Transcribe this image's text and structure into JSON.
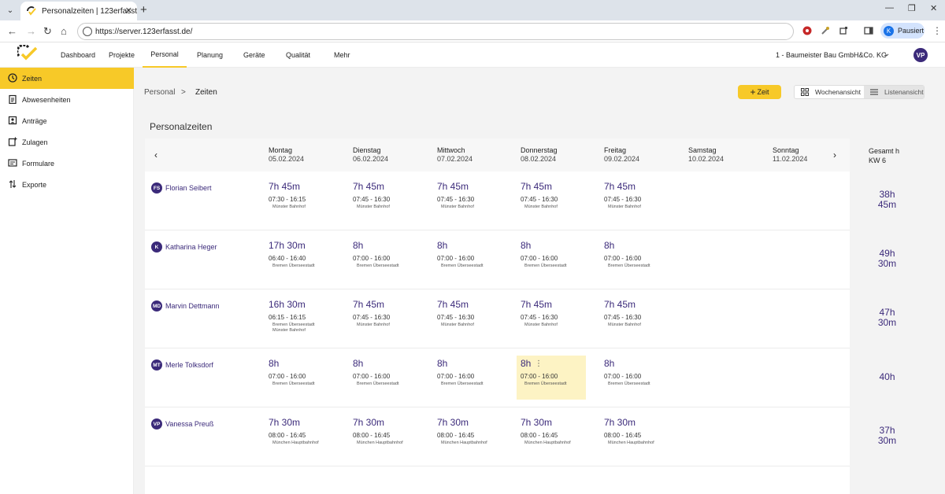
{
  "browser": {
    "tab_title": "Personalzeiten | 123erfasst",
    "url": "https://server.123erfasst.de/",
    "profile_label": "Pausiert",
    "profile_initial": "K"
  },
  "header": {
    "nav": [
      "Dashboard",
      "Projekte",
      "Personal",
      "Planung",
      "Geräte",
      "Qualität",
      "Mehr"
    ],
    "active_nav": "Personal",
    "company": "1 - Baumeister Bau GmbH&Co. KG",
    "user_initials": "VP"
  },
  "sidebar": {
    "items": [
      {
        "label": "Zeiten",
        "icon": "clock-icon",
        "active": true
      },
      {
        "label": "Abwesenheiten",
        "icon": "clipboard-icon",
        "active": false
      },
      {
        "label": "Anträge",
        "icon": "id-card-icon",
        "active": false
      },
      {
        "label": "Zulagen",
        "icon": "add-document-icon",
        "active": false
      },
      {
        "label": "Formulare",
        "icon": "form-icon",
        "active": false
      },
      {
        "label": "Exporte",
        "icon": "export-arrows-icon",
        "active": false
      }
    ]
  },
  "breadcrumb": {
    "parent": "Personal",
    "separator": ">",
    "current": "Zeiten"
  },
  "toolbar": {
    "add_label": "Zeit",
    "week_view_label": "Wochenansicht",
    "list_view_label": "Listenansicht"
  },
  "page_title": "Personalzeiten",
  "week": {
    "days": [
      {
        "name": "Montag",
        "date": "05.02.2024"
      },
      {
        "name": "Dienstag",
        "date": "06.02.2024"
      },
      {
        "name": "Mittwoch",
        "date": "07.02.2024"
      },
      {
        "name": "Donnerstag",
        "date": "08.02.2024"
      },
      {
        "name": "Freitag",
        "date": "09.02.2024"
      },
      {
        "name": "Samstag",
        "date": "10.02.2024"
      },
      {
        "name": "Sonntag",
        "date": "11.02.2024"
      }
    ],
    "total_label": "Gesamt h",
    "week_label": "KW 6"
  },
  "employees": [
    {
      "initials": "FS",
      "name": "Florian Seibert",
      "total_h": "38h",
      "total_m": "45m",
      "entries": [
        {
          "hours": "7h 45m",
          "range": "07:30 - 16:15",
          "locations": [
            "Münster Bahnhof"
          ]
        },
        {
          "hours": "7h 45m",
          "range": "07:45 - 16:30",
          "locations": [
            "Münster Bahnhof"
          ]
        },
        {
          "hours": "7h 45m",
          "range": "07:45 - 16:30",
          "locations": [
            "Münster Bahnhof"
          ]
        },
        {
          "hours": "7h 45m",
          "range": "07:45 - 16:30",
          "locations": [
            "Münster Bahnhof"
          ]
        },
        {
          "hours": "7h 45m",
          "range": "07:45 - 16:30",
          "locations": [
            "Münster Bahnhof"
          ]
        }
      ]
    },
    {
      "initials": "K",
      "name": "Katharina Heger",
      "total_h": "49h",
      "total_m": "30m",
      "entries": [
        {
          "hours": "17h 30m",
          "range": "06:40 - 16:40",
          "locations": [
            "Bremen Überseestadt"
          ]
        },
        {
          "hours": "8h",
          "range": "07:00 - 16:00",
          "locations": [
            "Bremen Überseestadt"
          ]
        },
        {
          "hours": "8h",
          "range": "07:00 - 16:00",
          "locations": [
            "Bremen Überseestadt"
          ]
        },
        {
          "hours": "8h",
          "range": "07:00 - 16:00",
          "locations": [
            "Bremen Überseestadt"
          ]
        },
        {
          "hours": "8h",
          "range": "07:00 - 16:00",
          "locations": [
            "Bremen Überseestadt"
          ]
        }
      ]
    },
    {
      "initials": "MD",
      "name": "Marvin Dettmann",
      "total_h": "47h",
      "total_m": "30m",
      "entries": [
        {
          "hours": "16h 30m",
          "range": "06:15 - 16:15",
          "locations": [
            "Bremen Überseestadt",
            "Münster Bahnhof"
          ]
        },
        {
          "hours": "7h 45m",
          "range": "07:45 - 16:30",
          "locations": [
            "Münster Bahnhof"
          ]
        },
        {
          "hours": "7h 45m",
          "range": "07:45 - 16:30",
          "locations": [
            "Münster Bahnhof"
          ]
        },
        {
          "hours": "7h 45m",
          "range": "07:45 - 16:30",
          "locations": [
            "Münster Bahnhof"
          ]
        },
        {
          "hours": "7h 45m",
          "range": "07:45 - 16:30",
          "locations": [
            "Münster Bahnhof"
          ]
        }
      ]
    },
    {
      "initials": "MT",
      "name": "Merle Tolksdorf",
      "total_h": "40h",
      "total_m": "",
      "entries": [
        {
          "hours": "8h",
          "range": "07:00 - 16:00",
          "locations": [
            "Bremen Überseestadt"
          ]
        },
        {
          "hours": "8h",
          "range": "07:00 - 16:00",
          "locations": [
            "Bremen Überseestadt"
          ]
        },
        {
          "hours": "8h",
          "range": "07:00 - 16:00",
          "locations": [
            "Bremen Überseestadt"
          ]
        },
        {
          "hours": "8h",
          "range": "07:00 - 16:00",
          "locations": [
            "Bremen Überseestadt"
          ],
          "highlighted": true
        },
        {
          "hours": "8h",
          "range": "07:00 - 16:00",
          "locations": [
            "Bremen Überseestadt"
          ]
        }
      ]
    },
    {
      "initials": "VP",
      "name": "Vanessa Preuß",
      "total_h": "37h",
      "total_m": "30m",
      "entries": [
        {
          "hours": "7h 30m",
          "range": "08:00 - 16:45",
          "locations": [
            "München Hauptbahnhof"
          ]
        },
        {
          "hours": "7h 30m",
          "range": "08:00 - 16:45",
          "locations": [
            "München Hauptbahnhof"
          ]
        },
        {
          "hours": "7h 30m",
          "range": "08:00 - 16:45",
          "locations": [
            "München Hauptbahnhof"
          ]
        },
        {
          "hours": "7h 30m",
          "range": "08:00 - 16:45",
          "locations": [
            "München Hauptbahnhof"
          ]
        },
        {
          "hours": "7h 30m",
          "range": "08:00 - 16:45",
          "locations": [
            "München Hauptbahnhof"
          ]
        }
      ]
    }
  ],
  "colors": {
    "accent": "#f7c928",
    "primary": "#3b2a7a"
  }
}
